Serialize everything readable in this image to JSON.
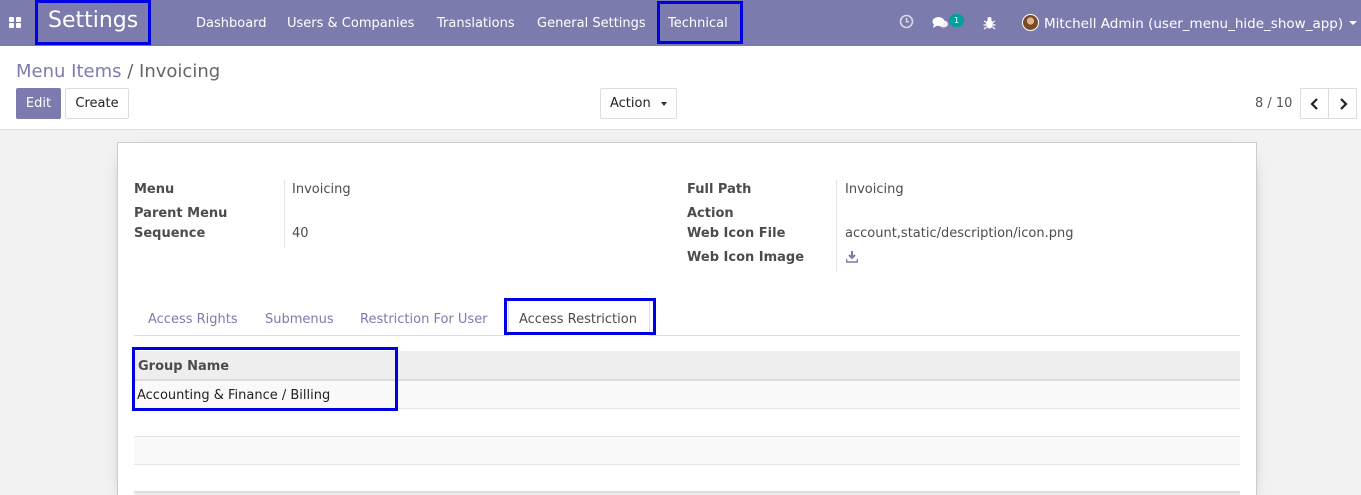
{
  "navbar": {
    "brand": "Settings",
    "items": [
      "Dashboard",
      "Users & Companies",
      "Translations",
      "General Settings",
      "Technical"
    ],
    "messages_badge": "1",
    "user": "Mitchell Admin (user_menu_hide_show_app)",
    "icons": [
      "apps-grid-icon",
      "clock-icon",
      "chat-icon",
      "bug-icon",
      "avatar"
    ]
  },
  "control_panel": {
    "breadcrumb_parent": "Menu Items",
    "breadcrumb_sep": "/",
    "breadcrumb_current": "Invoicing",
    "edit_label": "Edit",
    "create_label": "Create",
    "action_label": "Action",
    "pager": "8 / 10"
  },
  "form": {
    "menu_label": "Menu",
    "menu_value": "Invoicing",
    "parent_menu_label": "Parent Menu",
    "parent_menu_value": "",
    "sequence_label": "Sequence",
    "sequence_value": "40",
    "full_path_label": "Full Path",
    "full_path_value": "Invoicing",
    "action_label": "Action",
    "action_value": "",
    "web_icon_file_label": "Web Icon File",
    "web_icon_file_value": "account,static/description/icon.png",
    "web_icon_image_label": "Web Icon Image"
  },
  "tabs": [
    "Access Rights",
    "Submenus",
    "Restriction For User",
    "Access Restriction"
  ],
  "active_tab": "Access Restriction",
  "table": {
    "header": "Group Name",
    "rows": [
      "Accounting & Finance / Billing",
      "",
      ""
    ]
  },
  "colors": {
    "navbar": "#7c7bad",
    "primary": "#7c7bad",
    "highlight_box": "#0000e6",
    "badge": "#00a09d"
  }
}
